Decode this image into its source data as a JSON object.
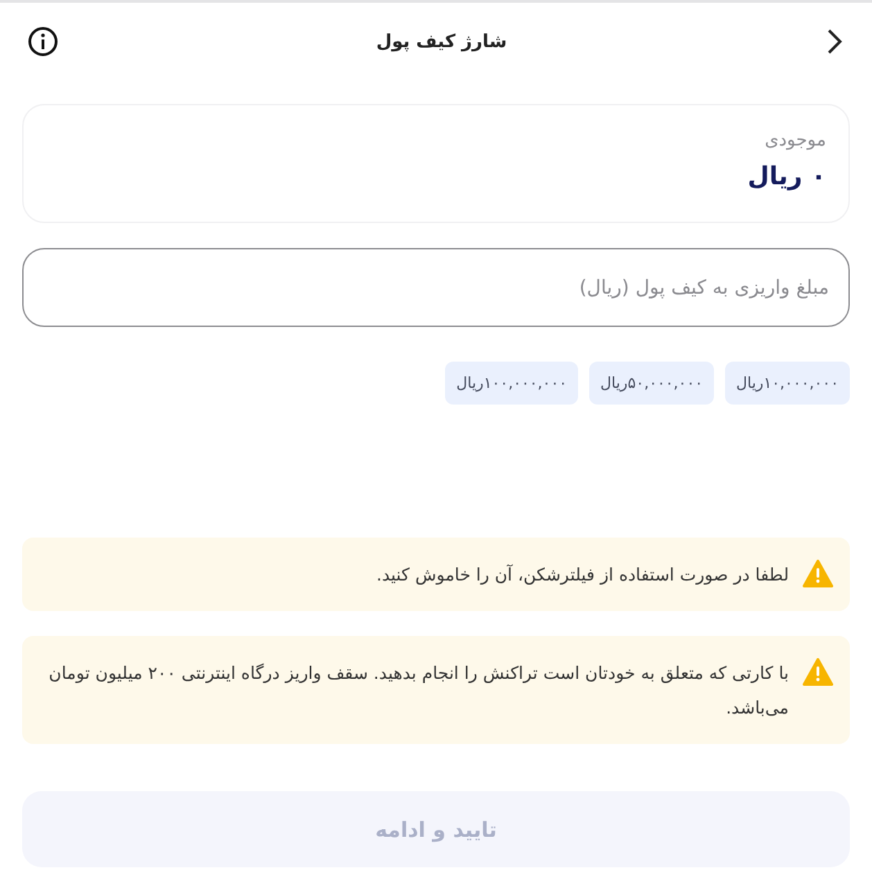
{
  "header": {
    "title": "شارژ کیف پول"
  },
  "balance": {
    "label": "موجودی",
    "value": "۰ ریال"
  },
  "amount_field": {
    "placeholder": "مبلغ واریزی به کیف پول (ریال)"
  },
  "presets": [
    {
      "label": "۱۰,۰۰۰,۰۰۰ریال"
    },
    {
      "label": "۵۰,۰۰۰,۰۰۰ریال"
    },
    {
      "label": "۱۰۰,۰۰۰,۰۰۰ریال"
    }
  ],
  "alerts": [
    {
      "kind": "warning",
      "text": "لطفا در صورت استفاده از فیلترشکن، آن را خاموش کنید."
    },
    {
      "kind": "warning",
      "text": "با کارتی که متعلق به خودتان است تراکنش را انجام بدهید. سقف واریز درگاه اینترنتی ۲۰۰ میلیون تومان می‌باشد."
    }
  ],
  "submit": {
    "label": "تایید و ادامه",
    "disabled": true
  }
}
